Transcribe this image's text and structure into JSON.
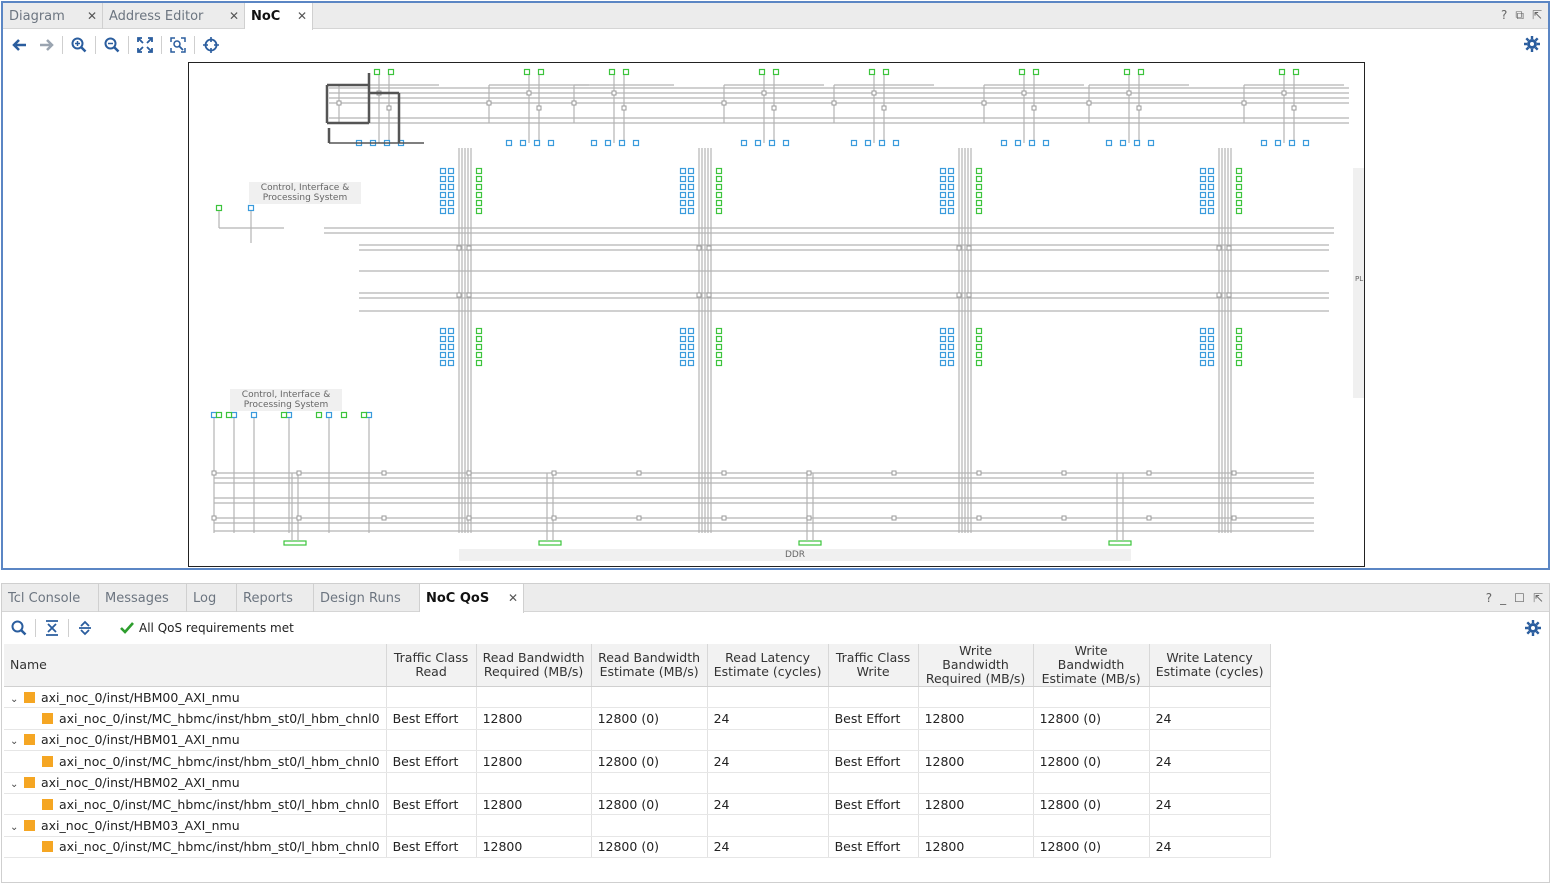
{
  "top_tabs": [
    {
      "label": "Diagram",
      "closable": true
    },
    {
      "label": "Address Editor",
      "closable": true
    },
    {
      "label": "NoC",
      "closable": true,
      "active": true
    }
  ],
  "top_window_controls": [
    "?",
    "restore",
    "float"
  ],
  "toolbar_icons": [
    "back-arrow-icon",
    "forward-arrow-icon",
    "zoom-in-icon",
    "zoom-out-icon",
    "zoom-fit-icon",
    "zoom-area-icon",
    "center-icon"
  ],
  "canvas": {
    "region_labels": {
      "cips_top": "Control, Interface &\nProcessing System",
      "cips_bottom": "Control, Interface &\nProcessing System",
      "ddr": "DDR",
      "pl": "PL"
    }
  },
  "bottom_tabs": [
    {
      "label": "Tcl Console"
    },
    {
      "label": "Messages"
    },
    {
      "label": "Log"
    },
    {
      "label": "Reports"
    },
    {
      "label": "Design Runs"
    },
    {
      "label": "NoC QoS",
      "closable": true,
      "active": true
    }
  ],
  "bottom_window_controls": [
    "?",
    "minimize",
    "maximize",
    "float"
  ],
  "qos_status": "All QoS requirements met",
  "table": {
    "headers": {
      "name": "Name",
      "tc_read": "Traffic Class\nRead",
      "rbw_req": "Read Bandwidth\nRequired (MB/s)",
      "rbw_est": "Read Bandwidth\nEstimate (MB/s)",
      "rlat": "Read Latency\nEstimate (cycles)",
      "tc_write": "Traffic Class\nWrite",
      "wbw_req": "Write Bandwidth\nRequired (MB/s)",
      "wbw_est": "Write Bandwidth\nEstimate (MB/s)",
      "wlat": "Write Latency\nEstimate (cycles)"
    },
    "groups": [
      {
        "name": "axi_noc_0/inst/HBM00_AXI_nmu",
        "child": {
          "name": "axi_noc_0/inst/MC_hbmc/inst/hbm_st0/l_hbm_chnl0",
          "tc_read": "Best Effort",
          "rbw_req": "12800",
          "rbw_est": "12800 (0)",
          "rlat": "24",
          "tc_write": "Best Effort",
          "wbw_req": "12800",
          "wbw_est": "12800 (0)",
          "wlat": "24"
        }
      },
      {
        "name": "axi_noc_0/inst/HBM01_AXI_nmu",
        "child": {
          "name": "axi_noc_0/inst/MC_hbmc/inst/hbm_st0/l_hbm_chnl0",
          "tc_read": "Best Effort",
          "rbw_req": "12800",
          "rbw_est": "12800 (0)",
          "rlat": "24",
          "tc_write": "Best Effort",
          "wbw_req": "12800",
          "wbw_est": "12800 (0)",
          "wlat": "24"
        }
      },
      {
        "name": "axi_noc_0/inst/HBM02_AXI_nmu",
        "child": {
          "name": "axi_noc_0/inst/MC_hbmc/inst/hbm_st0/l_hbm_chnl0",
          "tc_read": "Best Effort",
          "rbw_req": "12800",
          "rbw_est": "12800 (0)",
          "rlat": "24",
          "tc_write": "Best Effort",
          "wbw_req": "12800",
          "wbw_est": "12800 (0)",
          "wlat": "24"
        }
      },
      {
        "name": "axi_noc_0/inst/HBM03_AXI_nmu",
        "child": {
          "name": "axi_noc_0/inst/MC_hbmc/inst/hbm_st0/l_hbm_chnl0",
          "tc_read": "Best Effort",
          "rbw_req": "12800",
          "rbw_est": "12800 (0)",
          "rlat": "24",
          "tc_write": "Best Effort",
          "wbw_req": "12800",
          "wbw_est": "12800 (0)",
          "wlat": "24"
        }
      }
    ]
  },
  "colors": {
    "accent_border": "#5b86c4",
    "node_blue": "#3a9bdc",
    "node_green": "#3cc43c",
    "highlight_path": "#555555",
    "check_green": "#2e9e2e",
    "entity_orange": "#f5a623"
  }
}
